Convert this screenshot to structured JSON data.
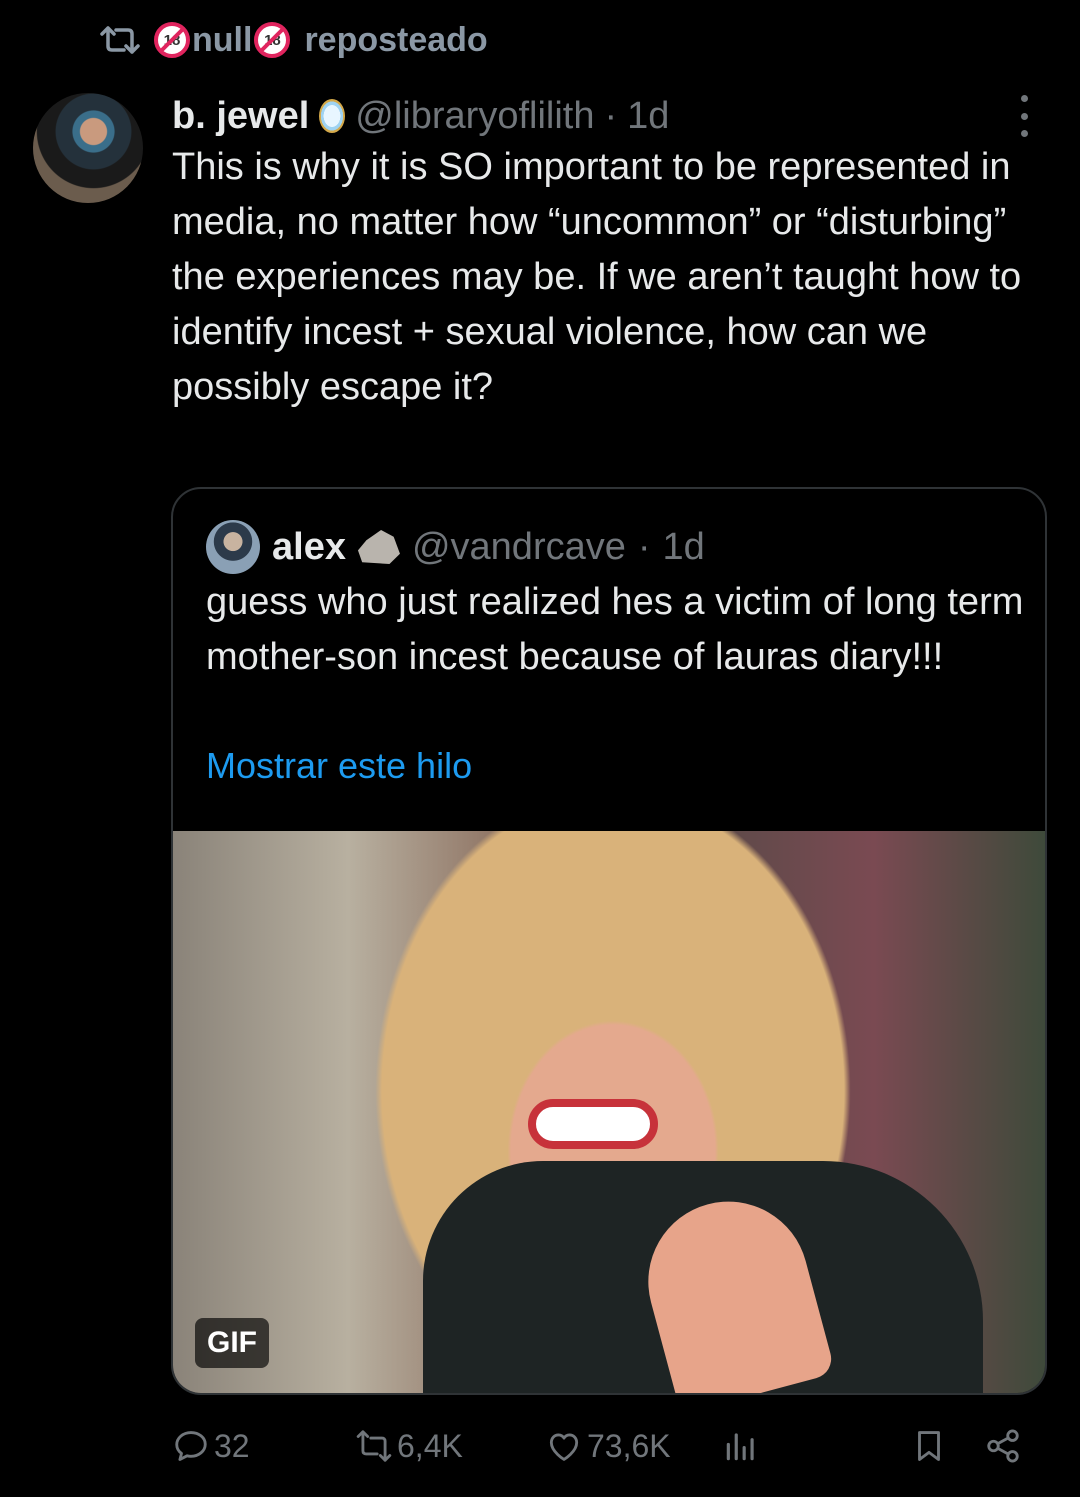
{
  "repost_banner": {
    "user": "null",
    "label": "reposteado"
  },
  "tweet": {
    "display_name": "b. jewel",
    "handle": "@libraryoflilith",
    "separator": "·",
    "time": "1d",
    "text": "This is why it is SO important to be represented in media, no matter how “uncommon” or “disturbing” the experiences may be. If we aren’t taught how to identify incest + sexual violence, how can we possibly escape it?"
  },
  "quoted_tweet": {
    "display_name": "alex",
    "handle": "@vandrcave",
    "separator": "·",
    "time": "1d",
    "text": "guess who just realized hes a victim of long term mother-son incest because of lauras diary!!!",
    "show_thread": "Mostrar este hilo",
    "media_badge": "GIF"
  },
  "actions": {
    "replies": "32",
    "reposts": "6,4K",
    "likes": "73,6K"
  },
  "colors": {
    "background": "#000000",
    "text": "#e7e9ea",
    "muted": "#71767b",
    "link": "#1d9bf0"
  }
}
